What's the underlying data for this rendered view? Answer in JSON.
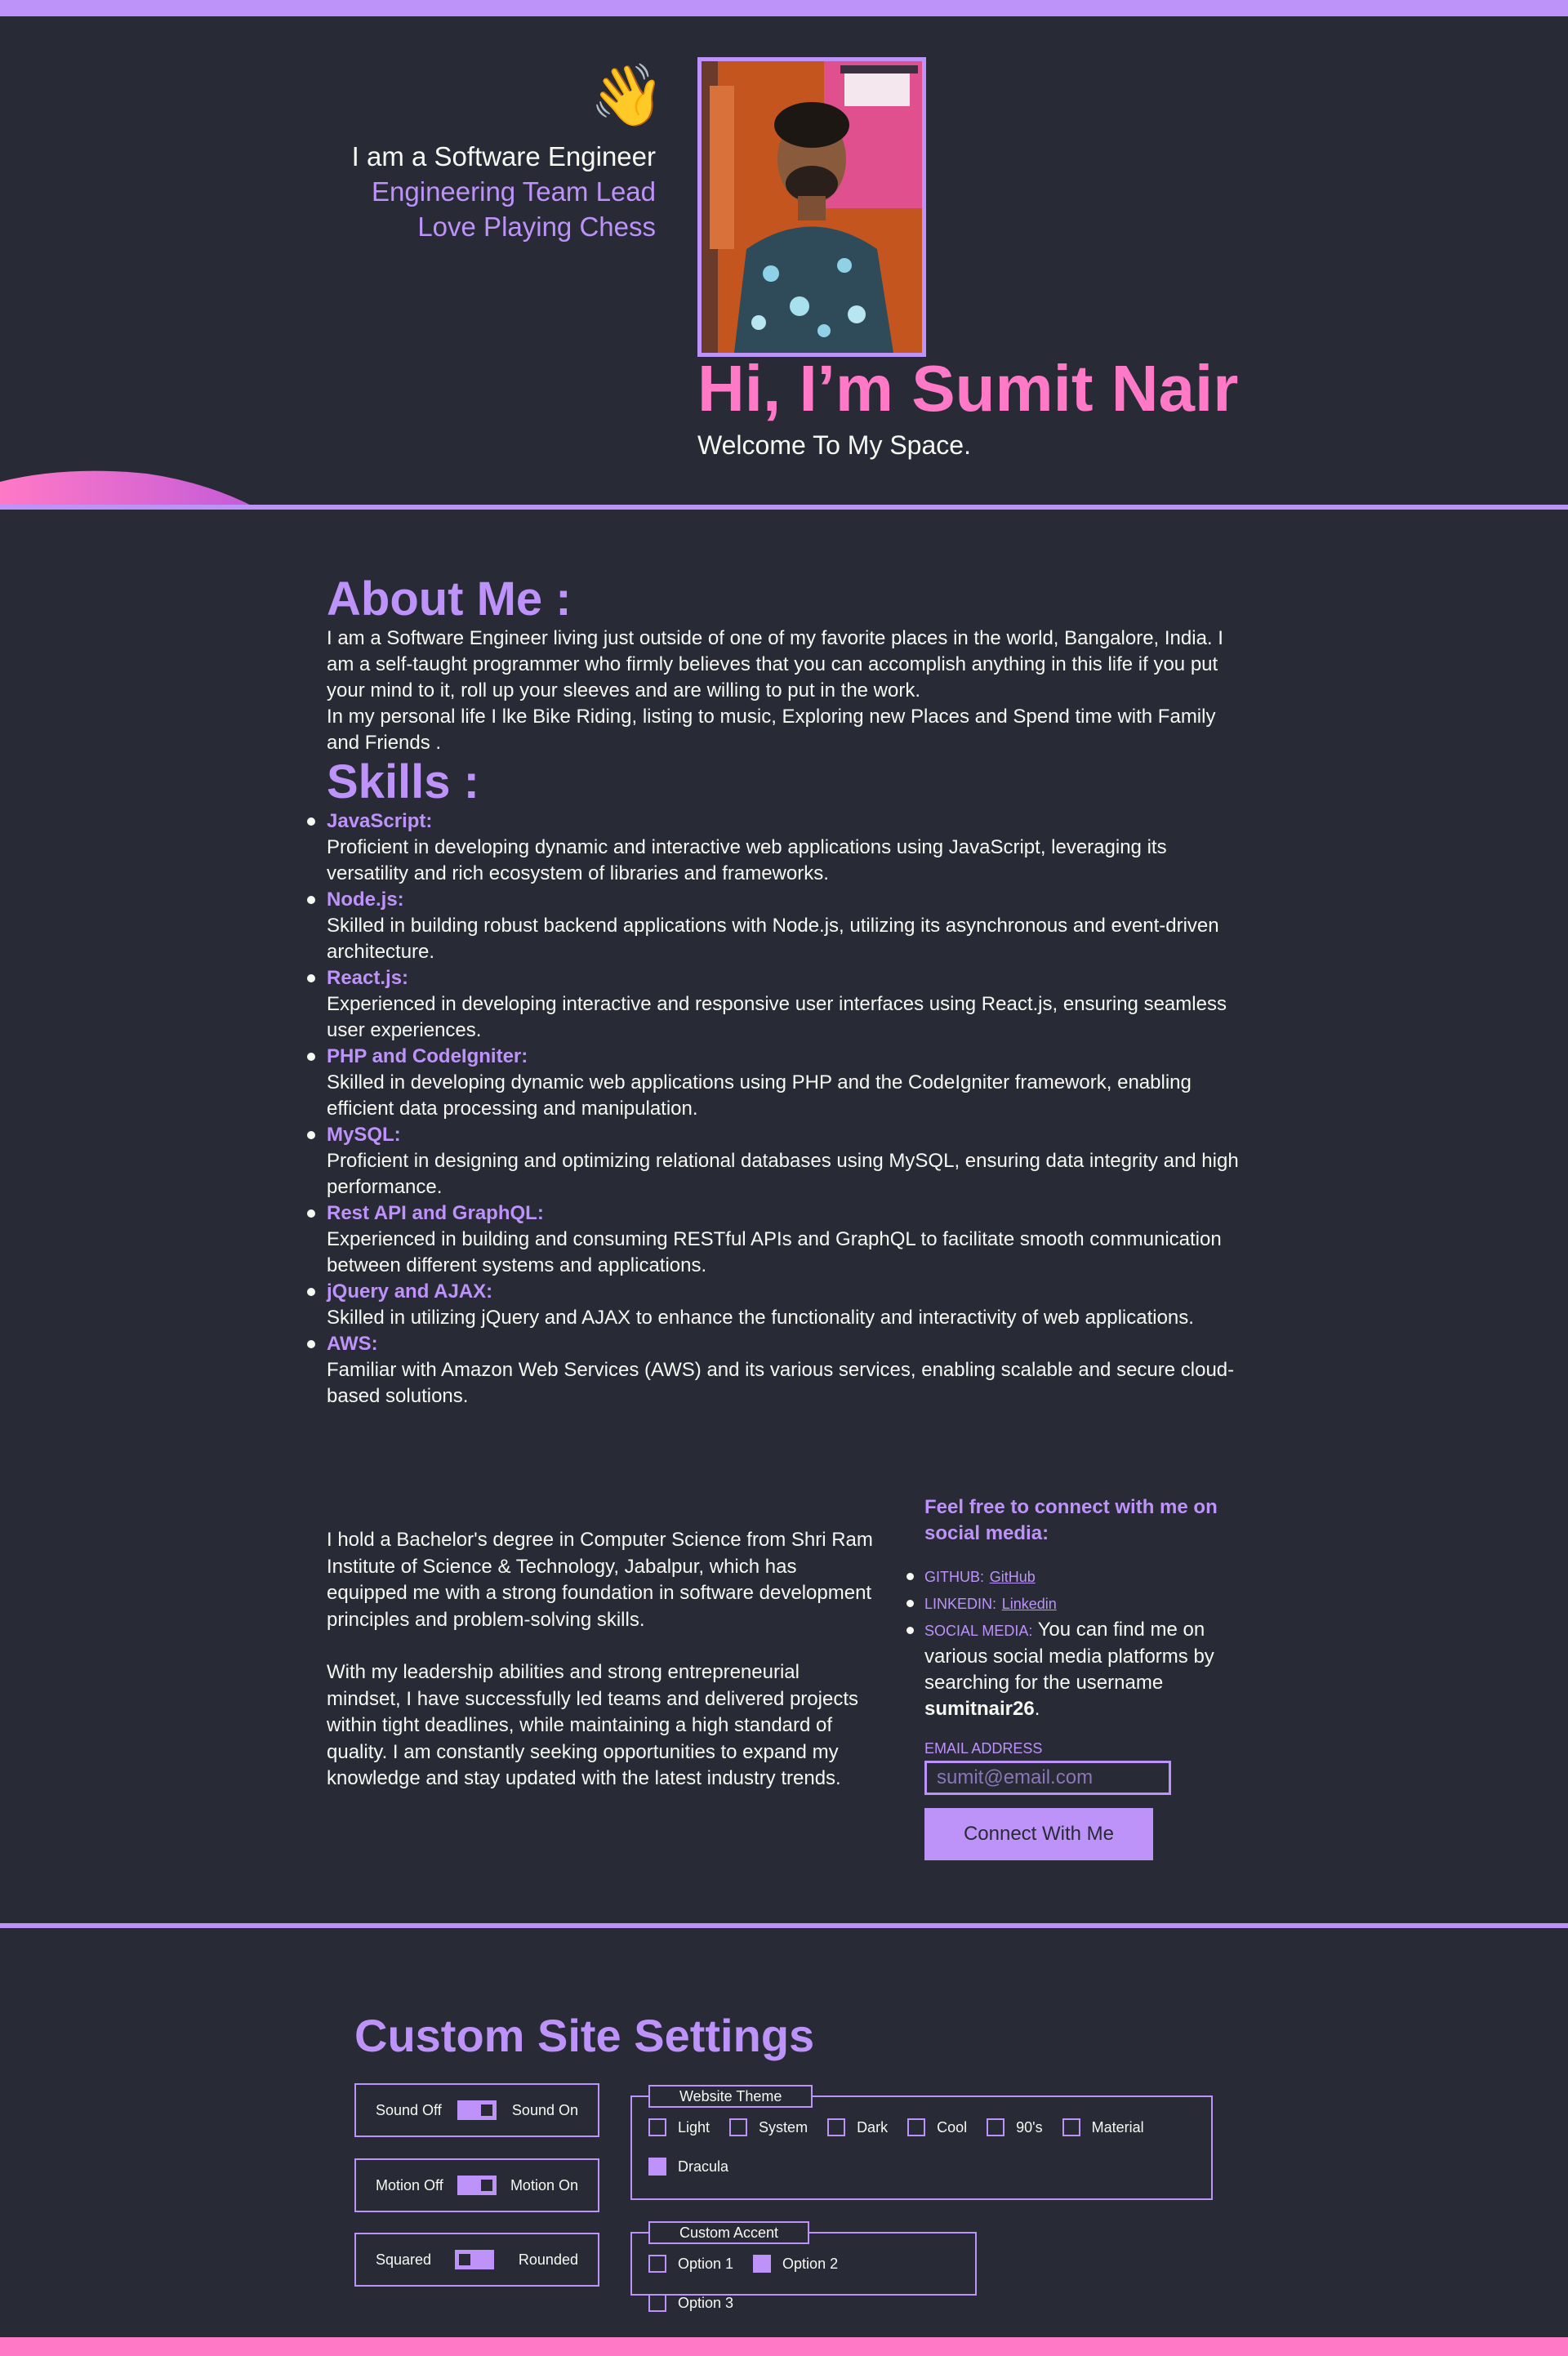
{
  "hero": {
    "wave_emoji": "👋",
    "taglines": [
      "I am a Software Engineer",
      "Engineering Team Lead",
      "Love Playing Chess"
    ],
    "title": "Hi, I’m Sumit Nair",
    "subtitle": "Welcome To My Space."
  },
  "about": {
    "heading": "About Me :",
    "paragraphs": [
      "I am a Software Engineer living just outside of one of my favorite places in the world, Bangalore, India. I am a self-taught programmer who firmly believes that you can accomplish anything in this life if you put your mind to it, roll up your sleeves and are willing to put in the work.",
      "In my personal life I lke Bike Riding, listing to music, Exploring new Places and Spend time with Family and Friends ."
    ]
  },
  "skills": {
    "heading": "Skills :",
    "items": [
      {
        "name": "JavaScript:",
        "desc": "Proficient in developing dynamic and interactive web applications using JavaScript, leveraging its versatility and rich ecosystem of libraries and frameworks."
      },
      {
        "name": "Node.js:",
        "desc": "Skilled in building robust backend applications with Node.js, utilizing its asynchronous and event-driven architecture."
      },
      {
        "name": "React.js:",
        "desc": "Experienced in developing interactive and responsive user interfaces using React.js, ensuring seamless user experiences."
      },
      {
        "name": "PHP and CodeIgniter:",
        "desc": "Skilled in developing dynamic web applications using PHP and the CodeIgniter framework, enabling efficient data processing and manipulation."
      },
      {
        "name": "MySQL:",
        "desc": "Proficient in designing and optimizing relational databases using MySQL, ensuring data integrity and high performance."
      },
      {
        "name": "Rest API and GraphQL:",
        "desc": "Experienced in building and consuming RESTful APIs and GraphQL to facilitate smooth communication between different systems and applications."
      },
      {
        "name": "jQuery and AJAX:",
        "desc": "Skilled in utilizing jQuery and AJAX to enhance the functionality and interactivity of web applications."
      },
      {
        "name": "AWS:",
        "desc": "Familiar with Amazon Web Services (AWS) and its various services, enabling scalable and secure cloud-based solutions."
      }
    ]
  },
  "education": {
    "paragraphs": [
      "I hold a Bachelor's degree in Computer Science from Shri Ram Institute of Science & Technology, Jabalpur, which has equipped me with a strong foundation in software development principles and problem-solving skills.",
      "With my leadership abilities and strong entrepreneurial mindset, I have successfully led teams and delivered projects within tight deadlines, while maintaining a high standard of quality. I am constantly seeking opportunities to expand my knowledge and stay updated with the latest industry trends."
    ]
  },
  "connect": {
    "heading": "Feel free to connect with me on social media:",
    "github_label": "GITHUB:",
    "github_link": "GitHub",
    "linkedin_label": "LINKEDIN:",
    "linkedin_link": "Linkedin",
    "social_label": "SOCIAL MEDIA:",
    "social_text": "You can find me on various social media platforms by searching for the username",
    "username": "sumitnair26",
    "period": ".",
    "email_label": "EMAIL ADDRESS",
    "email_placeholder": "sumit@email.com",
    "button": "Connect With Me"
  },
  "settings": {
    "heading": "Custom Site Settings",
    "sound": {
      "off": "Sound Off",
      "on": "Sound On",
      "state": "on"
    },
    "motion": {
      "off": "Motion Off",
      "on": "Motion On",
      "state": "on"
    },
    "corners": {
      "off": "Squared",
      "on": "Rounded",
      "state": "off"
    },
    "theme": {
      "legend": "Website Theme",
      "options": [
        "Light",
        "System",
        "Dark",
        "Cool",
        "90's",
        "Material",
        "Dracula"
      ],
      "selected": "Dracula"
    },
    "accent": {
      "legend": "Custom Accent",
      "options": [
        "Option 1",
        "Option 2",
        "Option 3"
      ],
      "selected": "Option 2"
    }
  },
  "colors": {
    "background": "#282a36",
    "accent": "#bd93f9",
    "title_pink": "#ff79c6",
    "text": "#f8f8f2"
  }
}
